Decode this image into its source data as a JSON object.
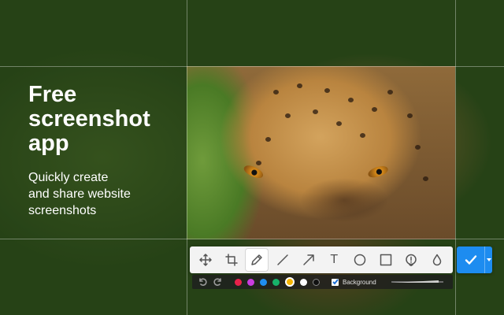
{
  "hero": {
    "headline": [
      "Free",
      "screenshot",
      "app"
    ],
    "subline": [
      "Quickly create",
      "and share website",
      "screenshots"
    ]
  },
  "toolbar": {
    "tools": [
      {
        "name": "move-icon",
        "active": false
      },
      {
        "name": "crop-icon",
        "active": false
      },
      {
        "name": "pencil-icon",
        "active": true
      },
      {
        "name": "line-icon",
        "active": false
      },
      {
        "name": "arrow-icon",
        "active": false
      },
      {
        "name": "text-icon",
        "active": false,
        "glyph": "T"
      },
      {
        "name": "circle-icon",
        "active": false
      },
      {
        "name": "rectangle-icon",
        "active": false
      },
      {
        "name": "counter-icon",
        "active": false,
        "glyph": "1"
      },
      {
        "name": "blur-drop-icon",
        "active": false
      }
    ],
    "confirm_icon": "check-icon",
    "dropdown_icon": "caret-down-icon"
  },
  "options": {
    "undo_icon": "undo-icon",
    "redo_icon": "redo-icon",
    "colors": [
      {
        "hex": "#e8214a",
        "selected": false
      },
      {
        "hex": "#c93de0",
        "selected": false
      },
      {
        "hex": "#1f8ef1",
        "selected": false
      },
      {
        "hex": "#17b26a",
        "selected": false
      },
      {
        "hex": "#f5b400",
        "selected": true
      },
      {
        "hex": "#ffffff",
        "selected": false
      },
      {
        "hex": "#111111",
        "selected": false
      }
    ],
    "background_checked": true,
    "background_label": "Background"
  },
  "accent": "#1d8cf0"
}
